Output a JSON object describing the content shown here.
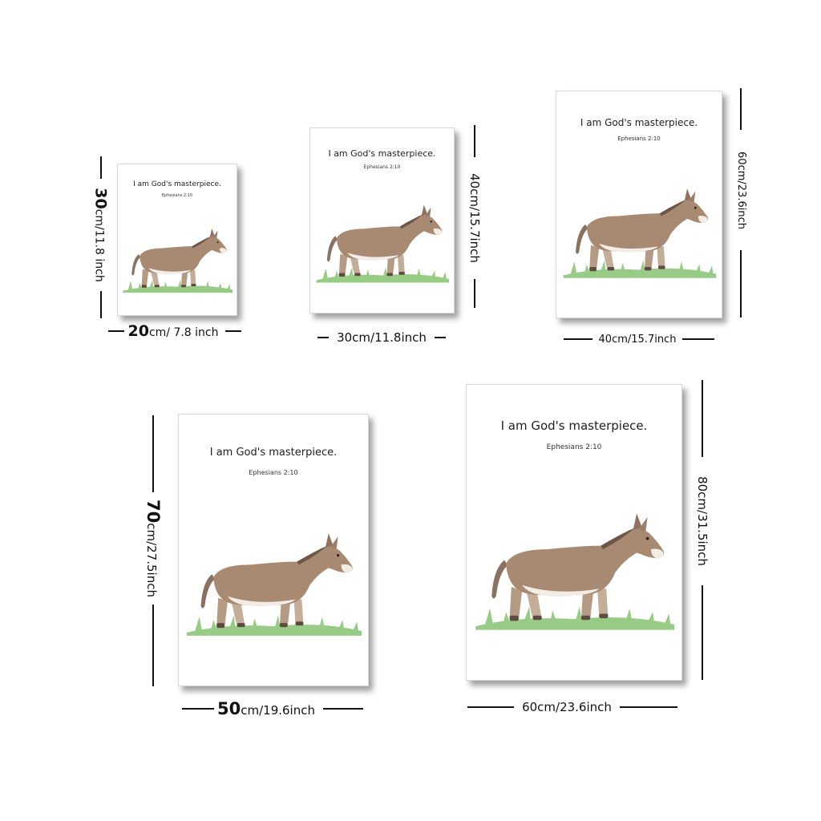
{
  "quote": "I am God's masterpiece.",
  "reference": "Ephesians 2:10",
  "sizes": [
    {
      "height_label_num": "30",
      "height_label_rest": "cm/11.8 inch",
      "width_label_num": "20",
      "width_label_rest": "cm/ 7.8 inch"
    },
    {
      "height_label": "40cm/15.7inch",
      "width_label": "30cm/11.8inch"
    },
    {
      "height_label": "60cm/23.6inch",
      "width_label": "40cm/15.7inch"
    },
    {
      "height_label_num": "70",
      "height_label_rest": "cm/27.5inch",
      "width_label_num": "50",
      "width_label_rest": "cm/19.6inch"
    },
    {
      "height_label": "80cm/31.5inch",
      "width_label": "60cm/23.6inch"
    }
  ],
  "colors": {
    "donkey": "#a88a72",
    "donkey_dark": "#7a6352",
    "belly": "#f2ece6",
    "grass": "#7fbf6a",
    "line": "#111111"
  },
  "icons": [
    "donkey-illustration"
  ]
}
